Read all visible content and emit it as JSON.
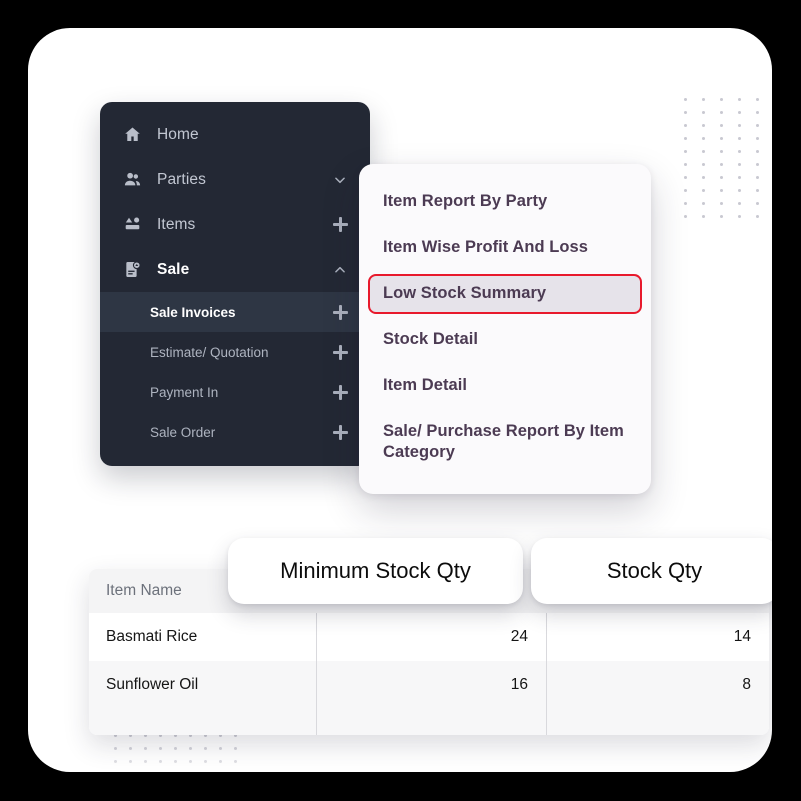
{
  "sidebar": {
    "items": [
      {
        "label": "Home",
        "icon": "home-icon",
        "affix": "none",
        "state": "normal"
      },
      {
        "label": "Parties",
        "icon": "people-icon",
        "affix": "chevron-down",
        "state": "normal"
      },
      {
        "label": "Items",
        "icon": "items-icon",
        "affix": "plus",
        "state": "normal"
      },
      {
        "label": "Sale",
        "icon": "document-icon",
        "affix": "chevron-up",
        "state": "expanded"
      }
    ],
    "subitems": [
      {
        "label": "Sale Invoices",
        "affix": "plus",
        "selected": true
      },
      {
        "label": "Estimate/ Quotation",
        "affix": "plus",
        "selected": false
      },
      {
        "label": "Payment In",
        "affix": "plus",
        "selected": false
      },
      {
        "label": "Sale Order",
        "affix": "plus",
        "selected": false
      }
    ]
  },
  "reports_menu": {
    "items": [
      {
        "label": "Item Report By Party",
        "highlighted": false
      },
      {
        "label": "Item Wise Profit And Loss",
        "highlighted": false
      },
      {
        "label": "Low Stock Summary",
        "highlighted": true
      },
      {
        "label": "Stock Detail",
        "highlighted": false
      },
      {
        "label": "Item Detail",
        "highlighted": false
      },
      {
        "label": "Sale/ Purchase Report By Item Category",
        "highlighted": false
      }
    ]
  },
  "header_pills": {
    "minimum_stock_qty": "Minimum Stock Qty",
    "stock_qty": "Stock Qty"
  },
  "table": {
    "columns": [
      "Item Name",
      "Minimum Stock Qty",
      "Stock Qty"
    ],
    "rows": [
      {
        "item_name": "Basmati  Rice",
        "minimum_stock_qty": "24",
        "stock_qty": "14"
      },
      {
        "item_name": "Sunflower Oil",
        "minimum_stock_qty": "16",
        "stock_qty": "8"
      }
    ]
  },
  "colors": {
    "page_background": "#000000",
    "card_background": "#ffffff",
    "sidebar_background": "#232834",
    "sidebar_selected": "#2e3644",
    "menu_background": "#fbfafc",
    "menu_text": "#4c3b53",
    "highlight_border": "#e8192c",
    "highlight_fill": "#e6e3ea",
    "table_header_background": "#f4f4f5",
    "table_header_text": "#6c717b",
    "table_alt_row": "#f7f7f8",
    "dot_pattern": "#c9c9d1"
  }
}
